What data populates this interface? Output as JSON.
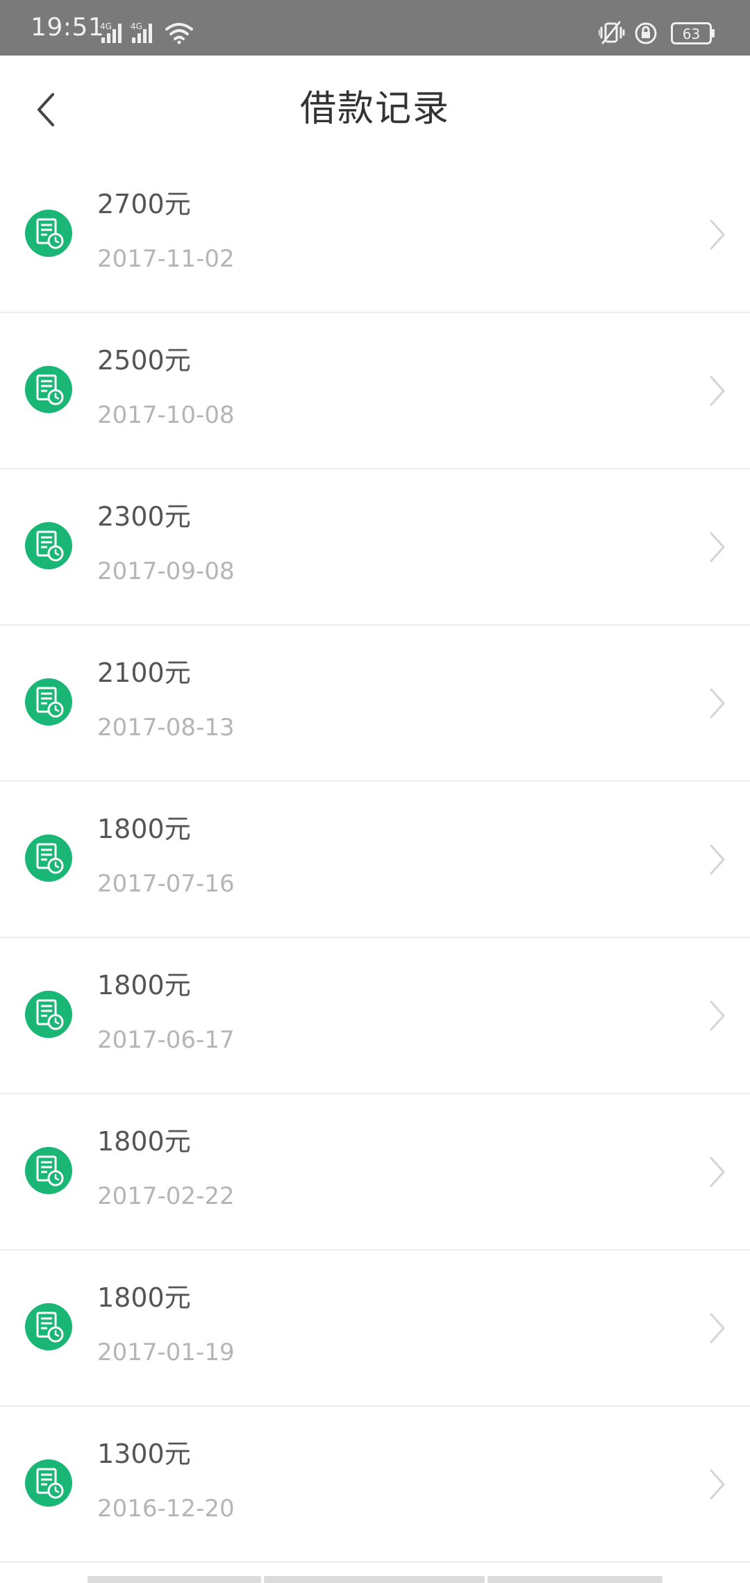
{
  "status_bar": {
    "time": "19:51",
    "signal_label_1": "4G",
    "signal_label_2": "4G",
    "battery": "63",
    "icons": [
      "signal-icon",
      "signal-icon",
      "wifi-icon",
      "vibrate-icon",
      "rotation-lock-icon",
      "battery-icon"
    ]
  },
  "header": {
    "title": "借款记录",
    "back_icon": "chevron-left-icon"
  },
  "colors": {
    "accent": "#1ab676",
    "amount_text": "#555555",
    "date_text": "#b5b5b5",
    "divider": "#ececec",
    "status_bar_bg": "#7a7a7a"
  },
  "records": [
    {
      "amount": "2700元",
      "date": "2017-11-02"
    },
    {
      "amount": "2500元",
      "date": "2017-10-08"
    },
    {
      "amount": "2300元",
      "date": "2017-09-08"
    },
    {
      "amount": "2100元",
      "date": "2017-08-13"
    },
    {
      "amount": "1800元",
      "date": "2017-07-16"
    },
    {
      "amount": "1800元",
      "date": "2017-06-17"
    },
    {
      "amount": "1800元",
      "date": "2017-02-22"
    },
    {
      "amount": "1800元",
      "date": "2017-01-19"
    },
    {
      "amount": "1300元",
      "date": "2016-12-20"
    }
  ]
}
